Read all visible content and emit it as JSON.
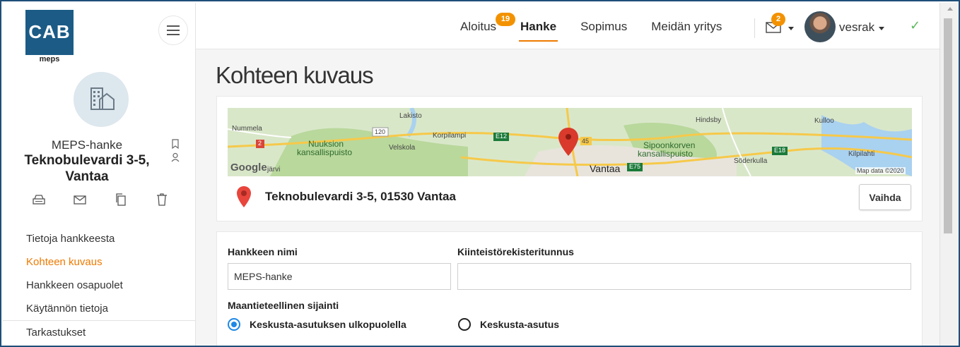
{
  "brand": {
    "logo_text": "CAB",
    "logo_sub": "meps"
  },
  "sidebar": {
    "project_name": "MEPS-hanke",
    "project_address_line1": "Teknobulevardi 3-5,",
    "project_address_line2": "Vantaa",
    "nav": [
      {
        "label": "Tietoja hankkeesta",
        "active": false
      },
      {
        "label": "Kohteen kuvaus",
        "active": true
      },
      {
        "label": "Hankkeen osapuolet",
        "active": false
      },
      {
        "label": "Käytännön tietoja",
        "active": false
      },
      {
        "label": "Tarkastukset",
        "active": false
      }
    ]
  },
  "header": {
    "tabs": [
      {
        "label": "Aloitus",
        "badge": "19"
      },
      {
        "label": "Hanke",
        "active": true
      },
      {
        "label": "Sopimus"
      },
      {
        "label": "Meidän yritys"
      }
    ],
    "mail_badge": "2",
    "username": "vesrak",
    "check": "✓"
  },
  "page": {
    "title": "Kohteen kuvaus",
    "map": {
      "labels": [
        "Lakisto",
        "Nummela",
        "Nuuksion",
        "kansallispuisto",
        "Korpilampi",
        "Velskola",
        "Hindsby",
        "Kulloo",
        "Sipoonkorven",
        "kansallispuisto",
        "Söderkulla",
        "Kilpilahti",
        "Vantaa",
        "järvi",
        "Map data ©2020",
        "120",
        "E12",
        "45",
        "E75",
        "E18",
        "2",
        "Google"
      ]
    },
    "address": "Teknobulevardi 3-5, 01530 Vantaa",
    "change_button": "Vaihda",
    "form": {
      "project_name_label": "Hankkeen nimi",
      "project_name_value": "MEPS-hanke",
      "registry_label": "Kiinteistörekisteritunnus",
      "registry_value": "",
      "location_label": "Maantieteellinen sijainti",
      "options": [
        {
          "label": "Keskusta-asutuksen ulkopuolella",
          "selected": true
        },
        {
          "label": "Keskusta-asutus",
          "selected": false
        }
      ]
    }
  },
  "colors": {
    "accent": "#ee7a00",
    "brand": "#1b5b86",
    "radio": "#1e88e5",
    "badge": "#f39200"
  }
}
